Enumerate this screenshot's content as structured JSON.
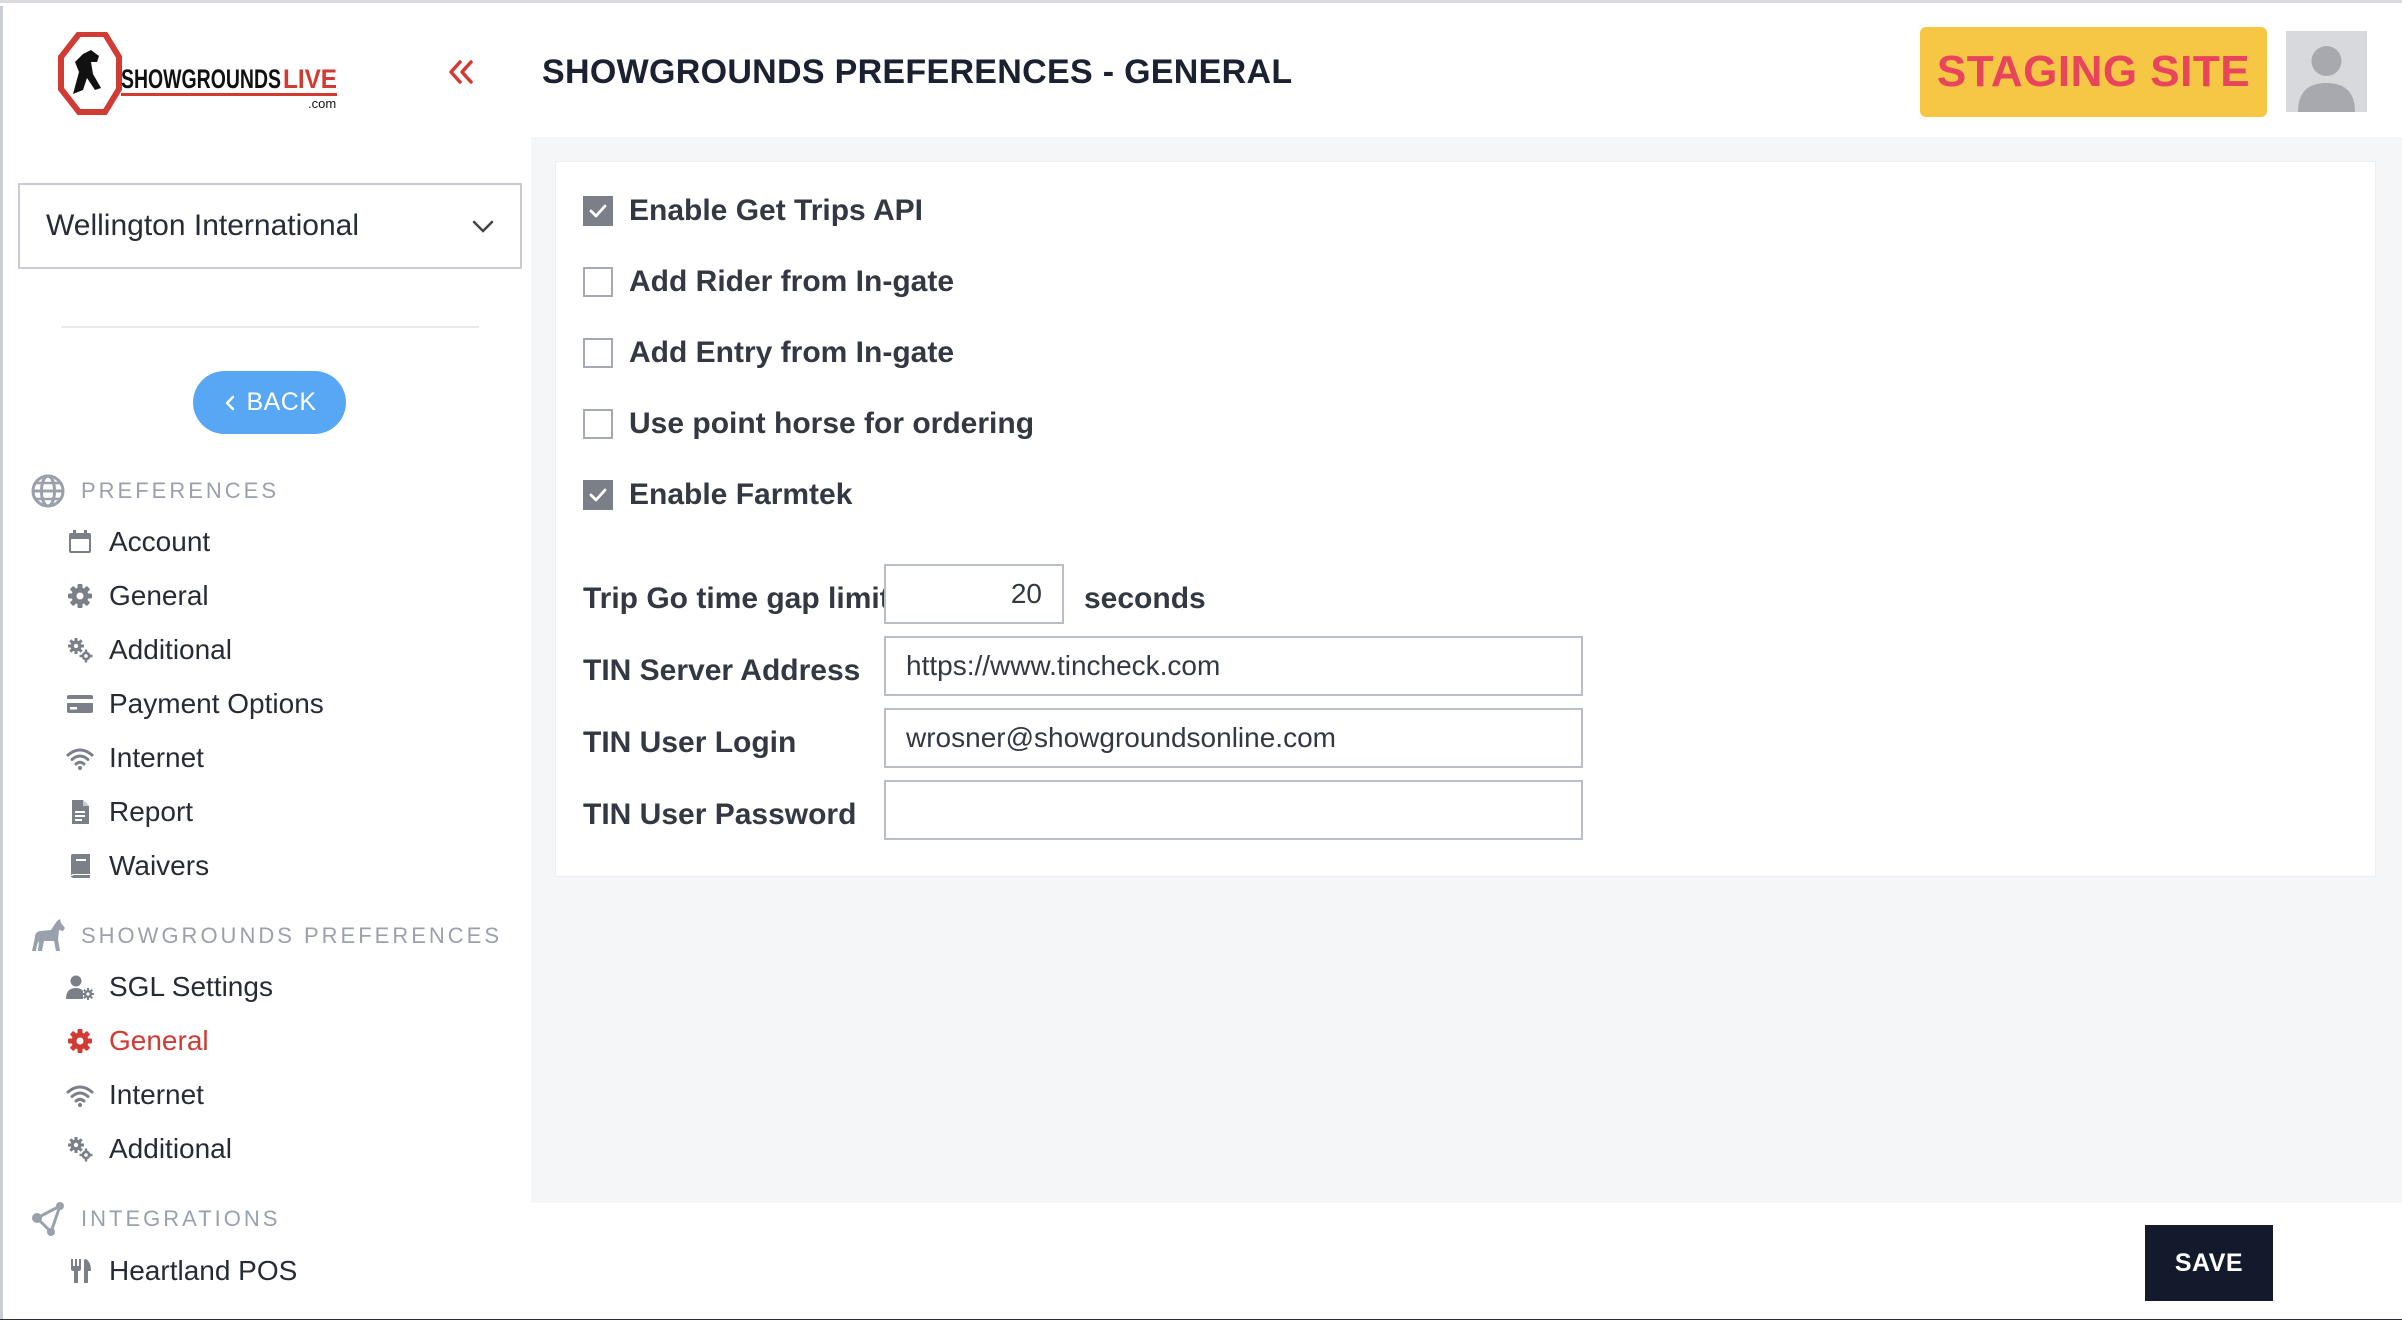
{
  "brand": {
    "logo_text": "SHOWGROUNDS",
    "logo_accent": "LIVE",
    "logo_sub": ".com",
    "accent_color": "#d23a34"
  },
  "header": {
    "title": "SHOWGROUNDS PREFERENCES - GENERAL",
    "staging_badge": "STAGING SITE"
  },
  "sidebar": {
    "show_select": "Wellington International",
    "back_label": "BACK",
    "sections": [
      {
        "label": "PREFERENCES",
        "icon": "globe-icon",
        "items": [
          {
            "label": "Account",
            "icon": "calendar-icon"
          },
          {
            "label": "General",
            "icon": "gear-icon"
          },
          {
            "label": "Additional",
            "icon": "gears-icon"
          },
          {
            "label": "Payment Options",
            "icon": "credit-card-icon"
          },
          {
            "label": "Internet",
            "icon": "wifi-icon"
          },
          {
            "label": "Report",
            "icon": "document-icon"
          },
          {
            "label": "Waivers",
            "icon": "book-icon"
          }
        ]
      },
      {
        "label": "SHOWGROUNDS PREFERENCES",
        "icon": "horse-icon",
        "items": [
          {
            "label": "SGL Settings",
            "icon": "user-gear-icon"
          },
          {
            "label": "General",
            "icon": "gear-icon",
            "active": true
          },
          {
            "label": "Internet",
            "icon": "wifi-icon"
          },
          {
            "label": "Additional",
            "icon": "gears-icon"
          }
        ]
      },
      {
        "label": "INTEGRATIONS",
        "icon": "network-icon",
        "items": [
          {
            "label": "Heartland POS",
            "icon": "utensils-icon"
          }
        ]
      }
    ]
  },
  "form": {
    "checkboxes": [
      {
        "label": "Enable Get Trips API",
        "checked": true
      },
      {
        "label": "Add Rider from In-gate",
        "checked": false
      },
      {
        "label": "Add Entry from In-gate",
        "checked": false
      },
      {
        "label": "Use point horse for ordering",
        "checked": false
      },
      {
        "label": "Enable Farmtek",
        "checked": true
      }
    ],
    "trip_gap": {
      "label": "Trip Go time gap limit",
      "value": "20",
      "unit": "seconds"
    },
    "tin_server": {
      "label": "TIN Server Address",
      "value": "https://www.tincheck.com"
    },
    "tin_login": {
      "label": "TIN User Login",
      "value": "wrosner@showgroundsonline.com"
    },
    "tin_password": {
      "label": "TIN User Password",
      "value": ""
    }
  },
  "footer": {
    "save_label": "SAVE"
  }
}
